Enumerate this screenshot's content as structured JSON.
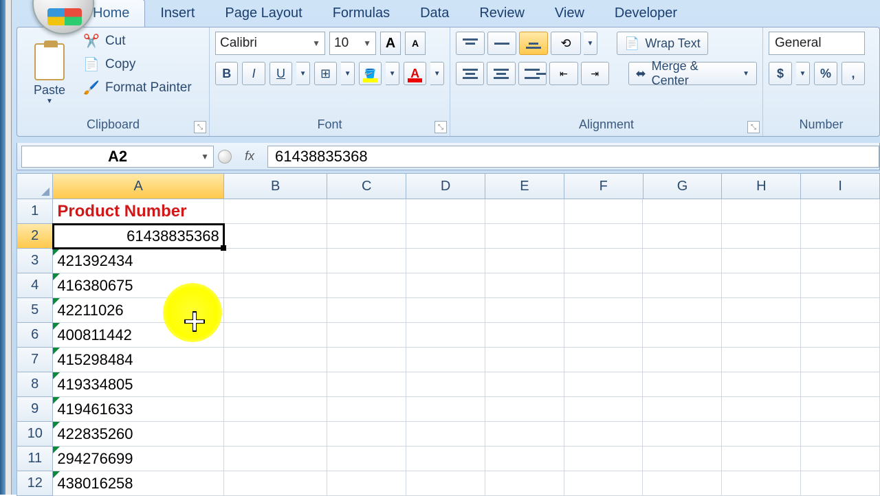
{
  "tabs": {
    "home": "Home",
    "insert": "Insert",
    "page_layout": "Page Layout",
    "formulas": "Formulas",
    "data": "Data",
    "review": "Review",
    "view": "View",
    "developer": "Developer"
  },
  "ribbon": {
    "clipboard": {
      "label": "Clipboard",
      "paste": "Paste",
      "cut": "Cut",
      "copy": "Copy",
      "format_painter": "Format Painter"
    },
    "font": {
      "label": "Font",
      "name": "Calibri",
      "size": "10"
    },
    "alignment": {
      "label": "Alignment",
      "wrap": "Wrap Text",
      "merge": "Merge & Center"
    },
    "number": {
      "label": "Number",
      "format": "General"
    }
  },
  "namebox": "A2",
  "formula": "61438835368",
  "columns": [
    "A",
    "B",
    "C",
    "D",
    "E",
    "F",
    "G",
    "H",
    "I"
  ],
  "row_headers": [
    "1",
    "2",
    "3",
    "4",
    "5",
    "6",
    "7",
    "8",
    "9",
    "10",
    "11",
    "12"
  ],
  "cells": {
    "A1": "Product Number",
    "A2": "61438835368",
    "A3": "421392434",
    "A4": "416380675",
    "A5": "42211026",
    "A6": "400811442",
    "A7": "415298484",
    "A8": "419334805",
    "A9": "419461633",
    "A10": "422835260",
    "A11": "294276699",
    "A12": "438016258"
  }
}
